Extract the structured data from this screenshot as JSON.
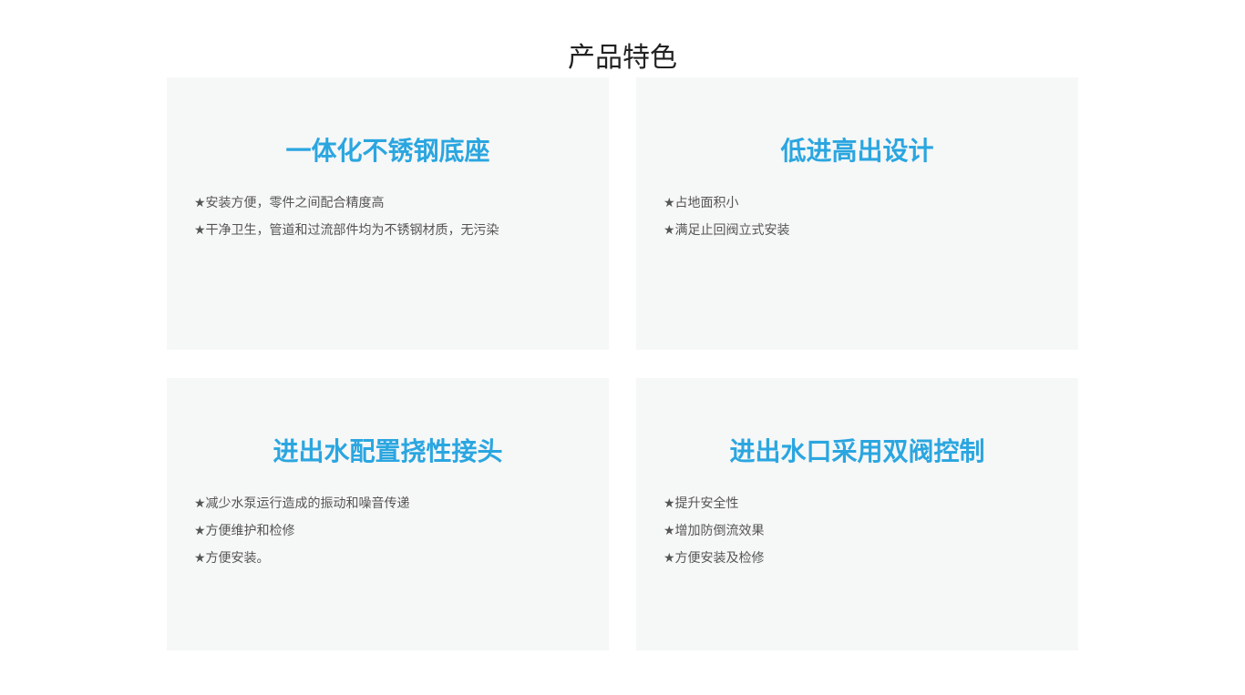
{
  "section": {
    "title": "产品特色"
  },
  "features": [
    {
      "title": "一体化不锈钢底座",
      "items": [
        "★安装方便，零件之间配合精度高",
        "★干净卫生，管道和过流部件均为不锈钢材质，无污染"
      ]
    },
    {
      "title": "低进高出设计",
      "items": [
        "★占地面积小",
        "★满足止回阀立式安装"
      ]
    },
    {
      "title": "进出水配置挠性接头",
      "items": [
        "★减少水泵运行造成的振动和噪音传递",
        "★方便维护和检修",
        "★方便安装。"
      ]
    },
    {
      "title": "进出水口采用双阀控制",
      "items": [
        "★提升安全性",
        "★增加防倒流效果",
        "★方便安装及检修"
      ]
    }
  ],
  "colors": {
    "accent": "#2aa6e0",
    "card_background": "#f6f7f7",
    "body_text": "#555555",
    "heading_text": "#222222"
  }
}
